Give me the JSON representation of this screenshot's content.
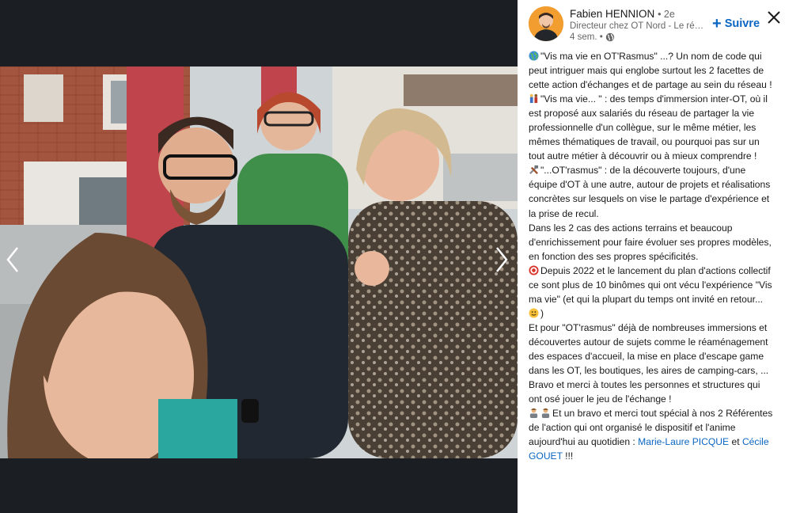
{
  "author": {
    "name": "Fabien HENNION",
    "degree": "• 2e",
    "headline": "Directeur chez OT Nord - Le réseau des offices de tourisme du Nord",
    "time": "4 sem. •",
    "avatar_icon": "person-avatar"
  },
  "actions": {
    "follow_label": "Suivre",
    "follow_icon": "plus-icon",
    "close_icon": "close-icon",
    "prev_icon": "chevron-left-icon",
    "next_icon": "chevron-right-icon"
  },
  "post": {
    "p1": "\"Vis ma vie en OT'Rasmus\" ...? Un nom de code qui peut intriguer mais qui englobe surtout les 2 facettes de cette action d'échanges et de partage au sein du réseau !",
    "p2": "\"Vis ma vie... \" : des temps d'immersion inter-OT, où il est proposé aux salariés du réseau de partager la vie professionnelle d'un collègue, sur le même métier, les mêmes thématiques de travail, ou pourquoi pas sur un tout autre métier à découvrir ou à mieux comprendre !",
    "p3": "\"...OT'rasmus\" : de la découverte toujours, d'une équipe d'OT à une autre, autour de projets et réalisations concrètes sur lesquels on vise le partage d'expérience et la prise de recul.",
    "p4": "Dans les 2 cas des actions terrains et beaucoup d'enrichissement pour faire évoluer ses propres modèles, en fonction des ses propres spécificités.",
    "p5": "Depuis 2022 et le lancement du plan d'actions collectif ce sont plus de 10 binômes qui ont vécu l'expérience \"Vis ma vie\" (et qui la plupart du temps ont invité en retour...",
    "p5_end": ")",
    "p6": "Et pour \"OT'rasmus\" déjà de nombreuses immersions et découvertes autour de sujets comme le réaménagement des espaces d'accueil, la mise en place d'escape game dans les OT, les boutiques, les aires de camping-cars, ...",
    "p7": "Bravo et merci à toutes les personnes et structures qui ont osé jouer le jeu de l'échange !",
    "p8": "Et un bravo et merci tout spécial à nos 2 Référentes de l'action qui ont organisé le dispositif et l'anime aujourd'hui au quotidien :",
    "mention1": "Marie-Laure PICQUE",
    "and": "et",
    "mention2": "Cécile GOUET",
    "p8_end": "!!!"
  },
  "colors": {
    "accent": "#0a66c2",
    "media_bg": "#1b1f23",
    "text": "#191919",
    "secondary": "#666666"
  }
}
